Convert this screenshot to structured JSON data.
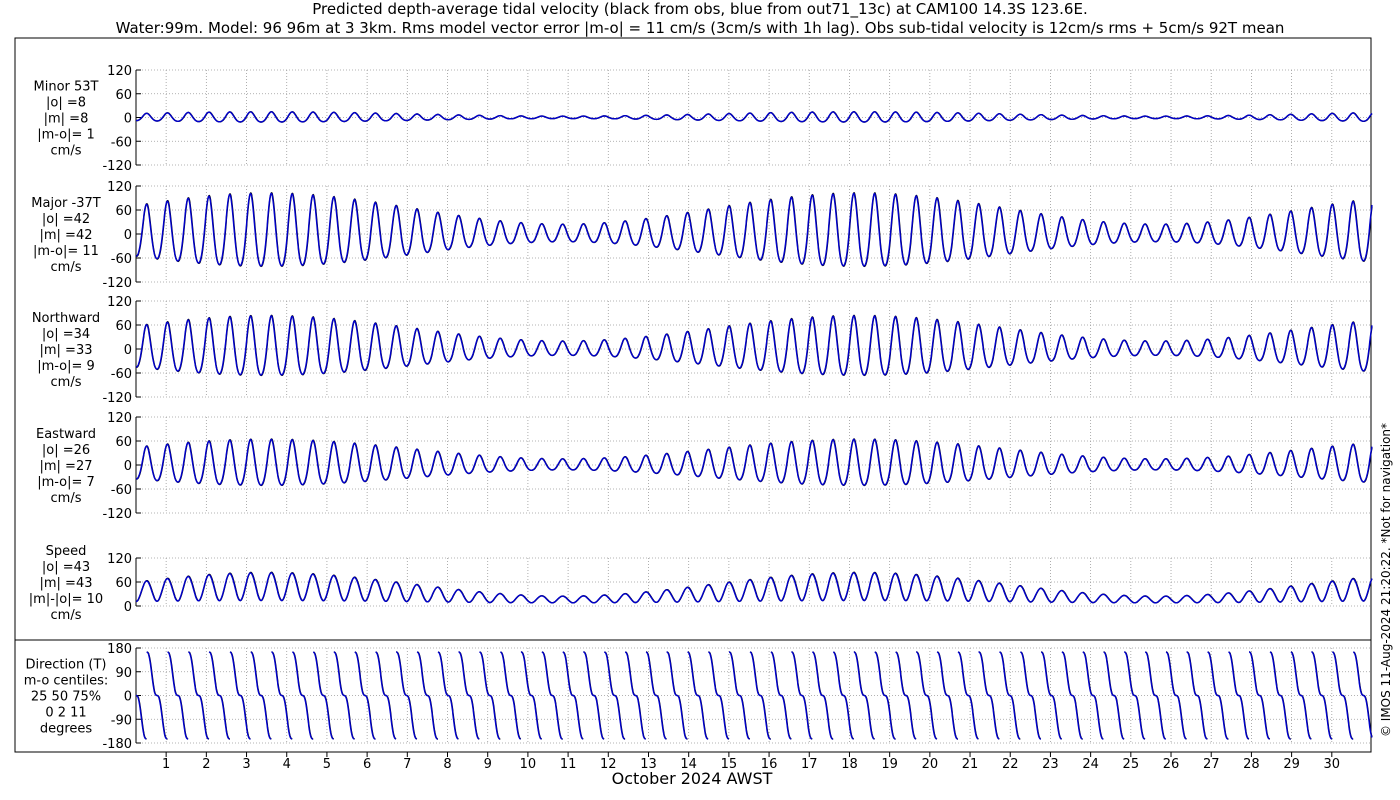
{
  "header": {
    "title_line1": "Predicted depth-average tidal velocity (black from obs, blue from out71_13c) at CAM100 14.3S 123.6E.",
    "title_line2": "Water:99m. Model: 96 96m at 3 3km. Rms model vector error |m-o| = 11 cm/s (3cm/s with 1h lag). Obs sub-tidal velocity is 12cm/s rms + 5cm/s 92T mean"
  },
  "watermark": "© IMOS 11-Aug-2024 21:20:22. *Not for navigation*",
  "chart_data": {
    "type": "line",
    "xlabel": "October 2024 AWST",
    "xlim": [
      0.25,
      31.0
    ],
    "x_ticks": [
      1,
      2,
      3,
      4,
      5,
      6,
      7,
      8,
      9,
      10,
      11,
      12,
      13,
      14,
      15,
      16,
      17,
      18,
      19,
      20,
      21,
      22,
      23,
      24,
      25,
      26,
      27,
      28,
      29,
      30
    ],
    "x_tick_labels": [
      "1",
      "2",
      "3",
      "4",
      "5",
      "6",
      "7",
      "8",
      "9",
      "10",
      "11",
      "12",
      "13",
      "14",
      "15",
      "16",
      "17",
      "18",
      "19",
      "20",
      "21",
      "22",
      "23",
      "24",
      "25",
      "26",
      "27",
      "28",
      "29",
      "30"
    ],
    "grid": true,
    "series_colors": {
      "obs": "#000000",
      "model": "#0000cc"
    },
    "panels": [
      {
        "id": "minor",
        "label_lines": [
          "Minor 53T",
          "|o| =8",
          "|m| =8",
          "|m-o|= 1",
          "cm/s"
        ],
        "ylim": [
          -120,
          120
        ],
        "yticks": [
          -120,
          -60,
          0,
          60,
          120
        ],
        "ytick_labels": [
          "-120",
          "-60",
          "0",
          "60",
          "120"
        ],
        "amplitude": 13,
        "mode": "velocity"
      },
      {
        "id": "major",
        "label_lines": [
          "Major -37T",
          "|o| =42",
          "|m| =42",
          "|m-o|= 11",
          "cm/s"
        ],
        "ylim": [
          -120,
          120
        ],
        "yticks": [
          -120,
          -60,
          0,
          60,
          120
        ],
        "ytick_labels": [
          "-120",
          "-60",
          "0",
          "60",
          "120"
        ],
        "amplitude": 92,
        "mode": "velocity"
      },
      {
        "id": "northward",
        "label_lines": [
          "Northward",
          "|o| =34",
          "|m| =33",
          "|m-o|= 9",
          "cm/s"
        ],
        "ylim": [
          -120,
          120
        ],
        "yticks": [
          -120,
          -60,
          0,
          60,
          120
        ],
        "ytick_labels": [
          "-120",
          "-60",
          "0",
          "60",
          "120"
        ],
        "amplitude": 75,
        "mode": "velocity"
      },
      {
        "id": "eastward",
        "label_lines": [
          "Eastward",
          "|o| =26",
          "|m| =27",
          "|m-o|= 7",
          "cm/s"
        ],
        "ylim": [
          -120,
          120
        ],
        "yticks": [
          -120,
          -60,
          0,
          60,
          120
        ],
        "ytick_labels": [
          "-120",
          "-60",
          "0",
          "60",
          "120"
        ],
        "amplitude": 58,
        "mode": "velocity"
      },
      {
        "id": "speed",
        "label_lines": [
          "Speed",
          "|o| =43",
          "|m| =43",
          "|m|-|o|= 10",
          "cm/s"
        ],
        "ylim": [
          0,
          120
        ],
        "yticks": [
          0,
          60,
          120
        ],
        "ytick_labels": [
          "0",
          "60",
          "120"
        ],
        "amplitude": 92,
        "mode": "speed"
      },
      {
        "id": "direction",
        "label_lines": [
          "Direction (T)",
          "m-o centiles:",
          "25  50  75%",
          "0   2   11",
          "degrees"
        ],
        "ylim": [
          -180,
          180
        ],
        "yticks": [
          -180,
          -90,
          0,
          90,
          180
        ],
        "ytick_labels": [
          "-180",
          "-90",
          "0",
          "90",
          "180"
        ],
        "mode": "direction"
      }
    ]
  }
}
